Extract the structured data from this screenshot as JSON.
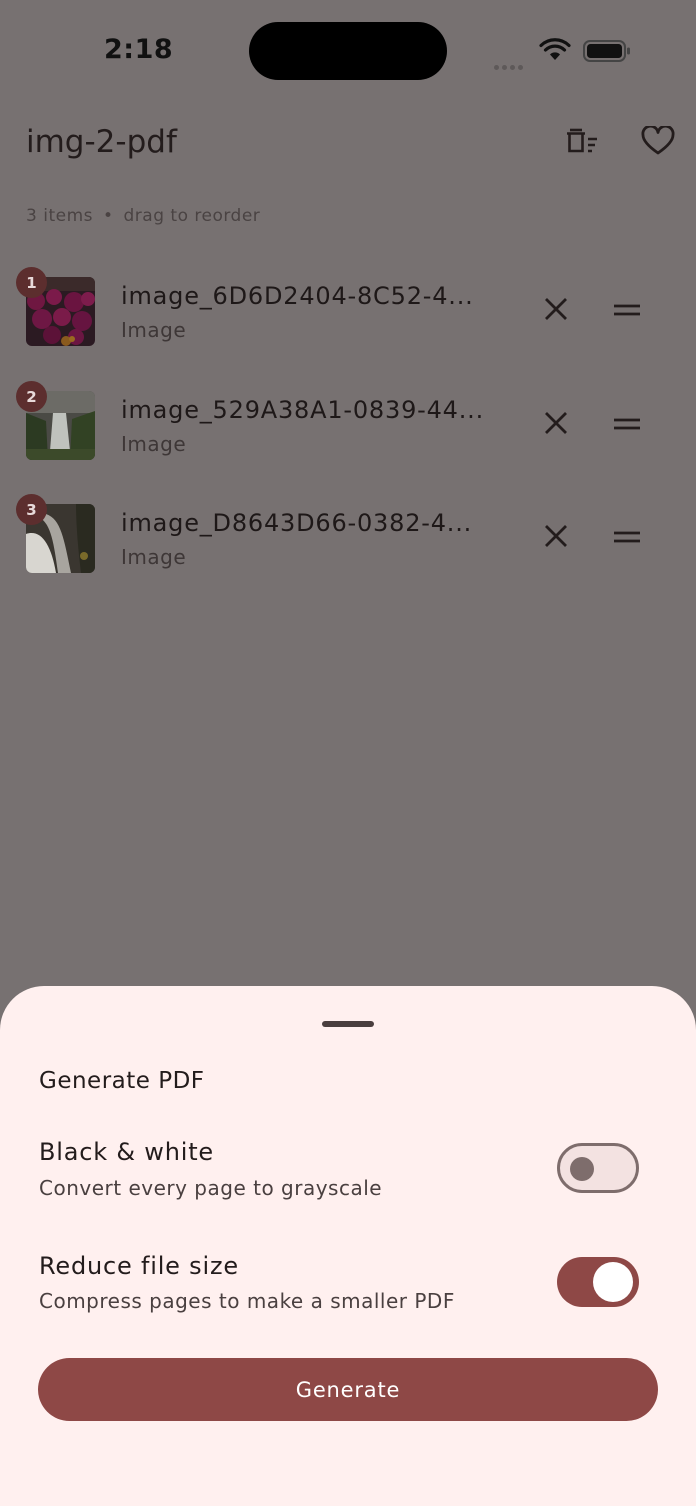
{
  "status_bar": {
    "time": "2:18"
  },
  "app_bar": {
    "title": "img-2-pdf"
  },
  "summary": {
    "count_text": "3 items",
    "separator": "•",
    "hint": "drag to reorder"
  },
  "items": [
    {
      "index": "1",
      "name": "image_6D6D2404-8C52-4...",
      "type": "Image"
    },
    {
      "index": "2",
      "name": "image_529A38A1-0839-44...",
      "type": "Image"
    },
    {
      "index": "3",
      "name": "image_D8643D66-0382-4...",
      "type": "Image"
    }
  ],
  "sheet": {
    "title": "Generate PDF",
    "options": [
      {
        "title": "Black & white",
        "description": "Convert every page to grayscale",
        "enabled": false
      },
      {
        "title": "Reduce file size",
        "description": "Compress pages to make a smaller PDF",
        "enabled": true
      }
    ],
    "generate_label": "Generate"
  },
  "colors": {
    "accent": "#8e4846",
    "sheet_bg": "#fff0ef",
    "scrim": "#777171"
  },
  "icons": [
    "wifi-icon",
    "battery-icon",
    "delete-sweep-icon",
    "heart-icon",
    "close-icon",
    "drag-handle-icon"
  ]
}
